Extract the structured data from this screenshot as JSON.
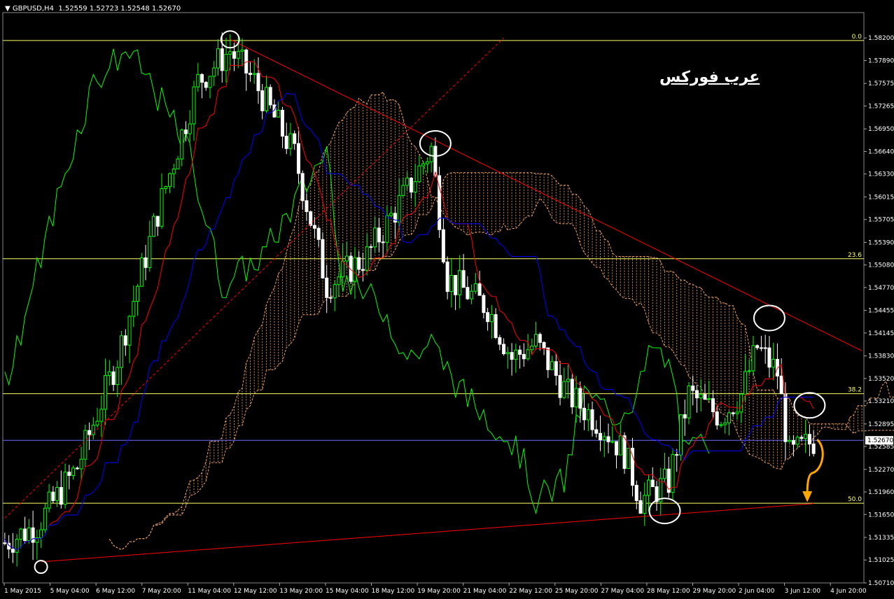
{
  "header": {
    "symbol": "GBPUSD,H4",
    "quotes": "1.52559 1.52723 1.52548 1.52670"
  },
  "watermark": "عرب فوركس",
  "colors": {
    "background": "#000000",
    "bull": "#00ff00",
    "bear": "#ffffff",
    "tenkan": "#ff0000",
    "kijun": "#0000ff",
    "chikou": "#00ff00",
    "cloud": "#f4a460",
    "fib": "#ffff66",
    "trendline": "#ff0000",
    "current_price": "#6a6aff",
    "arrow": "#ffa500"
  },
  "chart_data": {
    "type": "candlestick",
    "ylim": [
      1.5071,
      1.5851
    ],
    "y_ticks": [
      "1.58200",
      "1.57890",
      "1.57575",
      "1.57265",
      "1.56950",
      "1.56640",
      "1.56330",
      "1.56015",
      "1.55705",
      "1.55390",
      "1.55080",
      "1.54770",
      "1.54455",
      "1.54145",
      "1.53830",
      "1.53520",
      "1.53210",
      "1.52895",
      "1.52585",
      "1.52270",
      "1.51960",
      "1.51650",
      "1.51335",
      "1.51025",
      "1.50710"
    ],
    "x_ticks": [
      "1 May 2015",
      "5 May 04:00",
      "6 May 12:00",
      "7 May 20:00",
      "11 May 04:00",
      "12 May 12:00",
      "13 May 20:00",
      "15 May 04:00",
      "18 May 12:00",
      "19 May 20:00",
      "21 May 04:00",
      "22 May 12:00",
      "25 May 20:00",
      "27 May 04:00",
      "28 May 12:00",
      "29 May 20:00",
      "2 Jun 04:00",
      "3 Jun 12:00",
      "4 Jun 20:00"
    ],
    "current_price": "1.52670",
    "fib_levels": [
      {
        "label": "0.0",
        "price": 1.58165
      },
      {
        "label": "23.6",
        "price": 1.55165
      },
      {
        "label": "38.2",
        "price": 1.5331
      },
      {
        "label": "50.0",
        "price": 1.51805
      }
    ],
    "anchors": [
      {
        "t": 0,
        "p": 1.5126
      },
      {
        "t": 8,
        "p": 1.515
      },
      {
        "t": 18,
        "p": 1.523
      },
      {
        "t": 28,
        "p": 1.538
      },
      {
        "t": 38,
        "p": 1.558
      },
      {
        "t": 48,
        "p": 1.576
      },
      {
        "t": 56,
        "p": 1.5803
      },
      {
        "t": 62,
        "p": 1.576
      },
      {
        "t": 72,
        "p": 1.566
      },
      {
        "t": 80,
        "p": 1.548
      },
      {
        "t": 90,
        "p": 1.552
      },
      {
        "t": 100,
        "p": 1.561
      },
      {
        "t": 106,
        "p": 1.5668
      },
      {
        "t": 110,
        "p": 1.549
      },
      {
        "t": 120,
        "p": 1.545
      },
      {
        "t": 126,
        "p": 1.538
      },
      {
        "t": 132,
        "p": 1.54
      },
      {
        "t": 140,
        "p": 1.533
      },
      {
        "t": 148,
        "p": 1.529
      },
      {
        "t": 154,
        "p": 1.525
      },
      {
        "t": 158,
        "p": 1.5185
      },
      {
        "t": 165,
        "p": 1.521
      },
      {
        "t": 170,
        "p": 1.533
      },
      {
        "t": 178,
        "p": 1.53
      },
      {
        "t": 183,
        "p": 1.533
      },
      {
        "t": 187,
        "p": 1.5395
      },
      {
        "t": 192,
        "p": 1.536
      },
      {
        "t": 195,
        "p": 1.5245
      },
      {
        "t": 201,
        "p": 1.5267
      }
    ],
    "trendlines": [
      {
        "from": {
          "t": 56,
          "p": 1.5818
        },
        "to": {
          "t": 213,
          "p": 1.539
        },
        "style": "solid"
      },
      {
        "from": {
          "t": 9,
          "p": 1.51
        },
        "to": {
          "t": 201,
          "p": 1.518
        },
        "style": "solid"
      },
      {
        "from": {
          "t": 0,
          "p": 1.516
        },
        "to": {
          "t": 124,
          "p": 1.582
        },
        "style": "dotted"
      }
    ],
    "markers": [
      {
        "t": 56,
        "p": 1.5818
      },
      {
        "t": 9,
        "p": 1.5093
      },
      {
        "t": 107,
        "p": 1.5675
      },
      {
        "t": 190,
        "p": 1.5435
      },
      {
        "t": 200,
        "p": 1.5315
      },
      {
        "t": 164,
        "p": 1.517
      }
    ]
  }
}
